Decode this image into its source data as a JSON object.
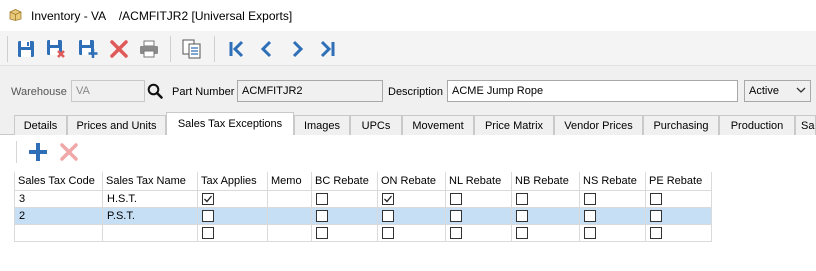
{
  "window": {
    "title": "Inventory - VA    /ACMFITJR2 [Universal Exports]"
  },
  "toolbar": {
    "icons": [
      "save-icon",
      "save-and-delete-icon",
      "save-and-new-icon",
      "delete-icon",
      "print-icon",
      "copy-icon",
      "first-record-icon",
      "previous-record-icon",
      "next-record-icon",
      "last-record-icon"
    ]
  },
  "header": {
    "warehouse_label": "Warehouse",
    "warehouse_value": "VA",
    "part_number_label": "Part Number",
    "part_number_value": "ACMFITJR2",
    "description_label": "Description",
    "description_value": "ACME Jump Rope",
    "status_value": "Active"
  },
  "tabs": [
    {
      "label": "Details"
    },
    {
      "label": "Prices and Units"
    },
    {
      "label": "Sales Tax Exceptions",
      "active": true
    },
    {
      "label": "Images"
    },
    {
      "label": "UPCs"
    },
    {
      "label": "Movement"
    },
    {
      "label": "Price Matrix"
    },
    {
      "label": "Vendor Prices"
    },
    {
      "label": "Purchasing"
    },
    {
      "label": "Production"
    },
    {
      "label": "Sa"
    }
  ],
  "panel_toolbar": {
    "icons": [
      "add-icon",
      "remove-icon"
    ]
  },
  "grid": {
    "columns": [
      "Sales Tax Code",
      "Sales Tax Name",
      "Tax Applies",
      "Memo",
      "BC Rebate",
      "ON Rebate",
      "NL Rebate",
      "NB Rebate",
      "NS Rebate",
      "PE Rebate"
    ],
    "rows": [
      {
        "code": "3",
        "name": "H.S.T.",
        "tax_applies": true,
        "memo": "",
        "bc_rebate": false,
        "on_rebate": true,
        "nl_rebate": false,
        "nb_rebate": false,
        "ns_rebate": false,
        "pe_rebate": false,
        "selected": false
      },
      {
        "code": "2",
        "name": "P.S.T.",
        "tax_applies": false,
        "memo": "",
        "bc_rebate": false,
        "on_rebate": false,
        "nl_rebate": false,
        "nb_rebate": false,
        "ns_rebate": false,
        "pe_rebate": false,
        "selected": true
      },
      {
        "code": "",
        "name": "",
        "tax_applies": false,
        "memo": "",
        "bc_rebate": false,
        "on_rebate": false,
        "nl_rebate": false,
        "nb_rebate": false,
        "ns_rebate": false,
        "pe_rebate": false,
        "selected": false
      }
    ]
  },
  "colors": {
    "accent_blue": "#2e6fb7",
    "delete_red": "#e05a5a",
    "selection": "#c7dff5"
  }
}
